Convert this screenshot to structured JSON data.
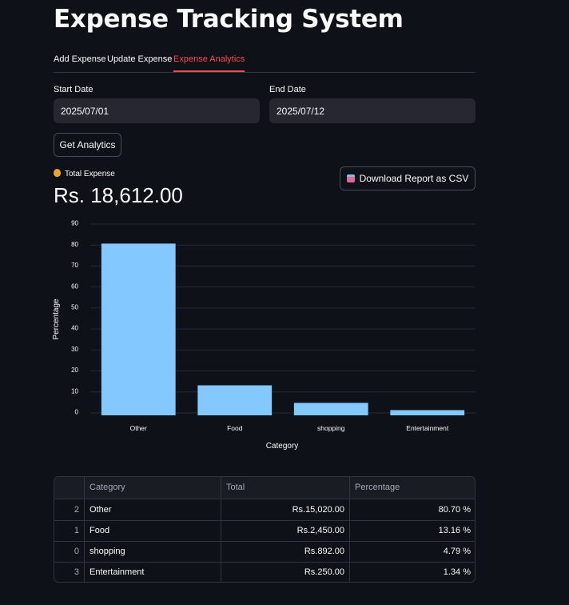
{
  "app": {
    "title": "Expense Tracking System"
  },
  "tabs": [
    {
      "label": "Add Expense",
      "active": false
    },
    {
      "label": "Update Expense",
      "active": false
    },
    {
      "label": "Expense Analytics",
      "active": true
    }
  ],
  "filters": {
    "start_label": "Start Date",
    "start_value": "2025/07/01",
    "end_label": "End Date",
    "end_value": "2025/07/12"
  },
  "actions": {
    "get_analytics_label": "Get Analytics",
    "download_label": "Download Report as CSV",
    "download_icon": "inbox-tray-icon"
  },
  "metric": {
    "icon": "money-bag-icon",
    "label": "Total Expense",
    "value": "Rs. 18,612.00"
  },
  "chart_data": {
    "type": "bar",
    "categories": [
      "Other",
      "Food",
      "shopping",
      "Entertainment"
    ],
    "values": [
      80.7,
      13.16,
      4.79,
      1.34
    ],
    "xlabel": "Category",
    "ylabel": "Percentage",
    "ylim": [
      0,
      90
    ],
    "yticks": [
      0,
      10,
      20,
      30,
      40,
      50,
      60,
      70,
      80,
      90
    ],
    "grid": true,
    "bar_color": "#83c9ff"
  },
  "table": {
    "columns": [
      "",
      "Category",
      "Total",
      "Percentage"
    ],
    "rows": [
      {
        "index": "2",
        "category": "Other",
        "total": "Rs.15,020.00",
        "percentage": "80.70 %"
      },
      {
        "index": "1",
        "category": "Food",
        "total": "Rs.2,450.00",
        "percentage": "13.16 %"
      },
      {
        "index": "0",
        "category": "shopping",
        "total": "Rs.892.00",
        "percentage": "4.79 %"
      },
      {
        "index": "3",
        "category": "Entertainment",
        "total": "Rs.250.00",
        "percentage": "1.34 %"
      }
    ]
  },
  "colors": {
    "background": "#0e1117",
    "accent": "#ff4b4b",
    "input_bg": "#262730"
  }
}
